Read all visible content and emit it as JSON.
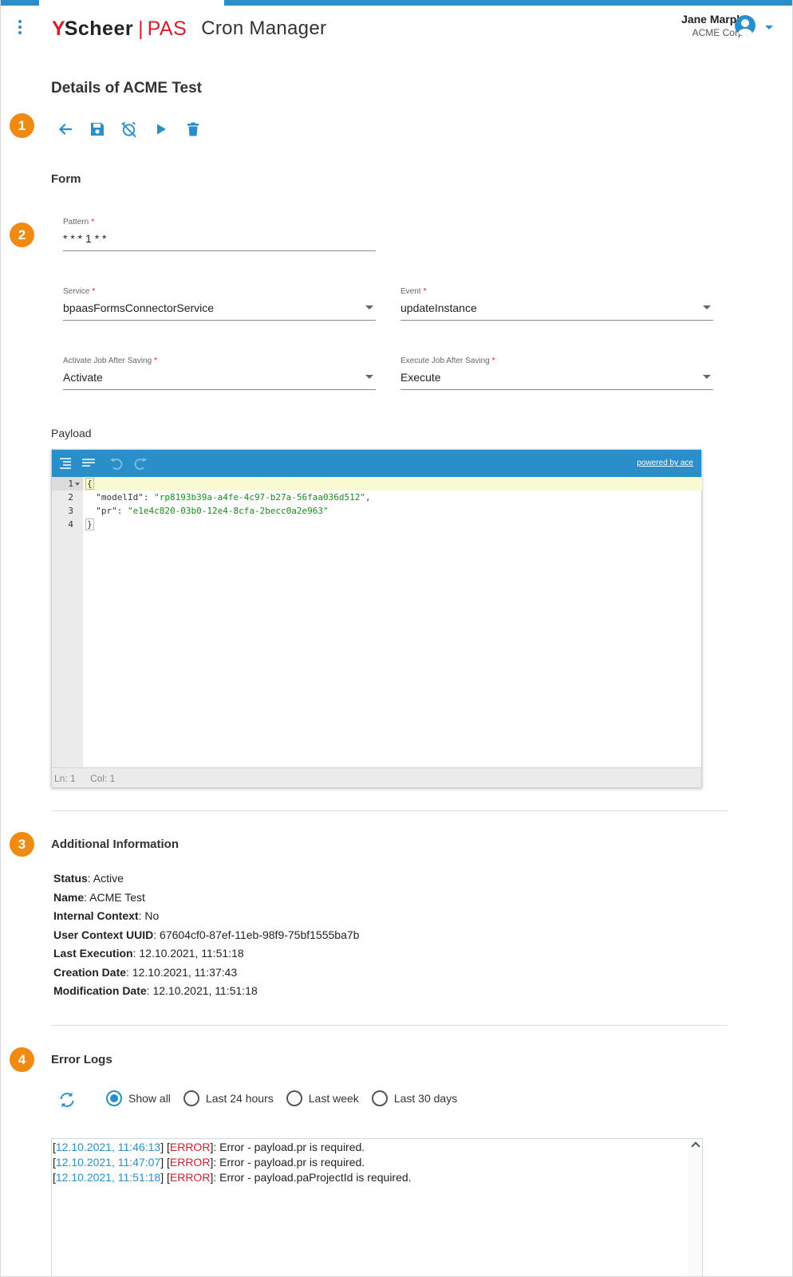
{
  "header": {
    "logo_mark": "Y",
    "logo_name": "Scheer",
    "logo_sep": "|",
    "logo_product": "PAS",
    "app_title": "Cron Manager",
    "user_name": "Jane Marple",
    "user_org": "ACME Corp."
  },
  "page": {
    "title": "Details of ACME Test"
  },
  "steps": [
    "1",
    "2",
    "3",
    "4"
  ],
  "toolbar": {
    "icons": [
      "back-arrow-icon",
      "save-icon",
      "alarm-off-icon",
      "play-icon",
      "delete-icon"
    ]
  },
  "form": {
    "heading": "Form",
    "required_marker": "*",
    "pattern": {
      "label": "Pattern",
      "value": "* * * 1 * *"
    },
    "service": {
      "label": "Service",
      "value": "bpaasFormsConnectorService"
    },
    "event": {
      "label": "Event",
      "value": "updateInstance"
    },
    "activate": {
      "label": "Activate Job After Saving",
      "value": "Activate"
    },
    "execute": {
      "label": "Execute Job After Saving",
      "value": "Execute"
    }
  },
  "payload": {
    "label": "Payload",
    "powered_by": "powered by ace",
    "line_numbers": [
      "1",
      "2",
      "3",
      "4"
    ],
    "lines": {
      "l1": "{",
      "l2_key": "  \"modelId\"",
      "l2_sep": ": ",
      "l2_val": "\"rp8193b39a-a4fe-4c97-b27a-56faa036d512\"",
      "l2_end": ",",
      "l3_key": "  \"pr\"",
      "l3_sep": ": ",
      "l3_val": "\"e1e4c820-03b0-12e4-8cfa-2becc0a2e963\"",
      "l4": "}"
    },
    "status_ln": "Ln: 1",
    "status_col": "Col: 1"
  },
  "additional": {
    "heading": "Additional Information",
    "rows": [
      {
        "label": "Status",
        "value": ": Active"
      },
      {
        "label": "Name",
        "value": ": ACME Test"
      },
      {
        "label": "Internal Context",
        "value": ": No"
      },
      {
        "label": "User Context UUID",
        "value": ": 67604cf0-87ef-11eb-98f9-75bf1555ba7b"
      },
      {
        "label": "Last Execution",
        "value": ": 12.10.2021, 11:51:18"
      },
      {
        "label": "Creation Date",
        "value": ": 12.10.2021, 11:37:43"
      },
      {
        "label": "Modification Date",
        "value": ": 12.10.2021, 11:51:18"
      }
    ]
  },
  "error_logs": {
    "heading": "Error Logs",
    "filters": [
      "Show all",
      "Last 24 hours",
      "Last week",
      "Last 30 days"
    ],
    "selected_filter": "Show all",
    "entries": [
      {
        "ts": "12.10.2021, 11:46:13",
        "level": "ERROR",
        "message": ": Error - payload.pr is required."
      },
      {
        "ts": "12.10.2021, 11:47:07",
        "level": "ERROR",
        "message": ": Error - payload.pr is required."
      },
      {
        "ts": "12.10.2021, 11:51:18",
        "level": "ERROR",
        "message": ": Error - payload.paProjectId is required."
      }
    ]
  },
  "colors": {
    "accent": "#2a8fc9",
    "brand_red": "#d0202e",
    "step_badge": "#ef8a12",
    "code_string": "#1a8a1a"
  }
}
